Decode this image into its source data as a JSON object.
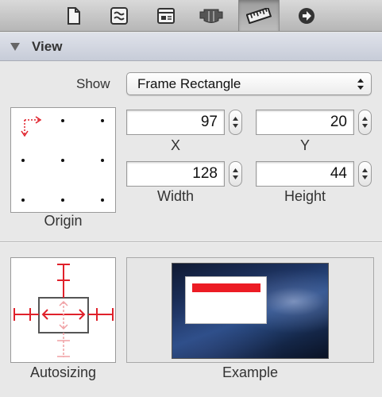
{
  "toolbar": {
    "tabs": [
      {
        "icon": "document-icon",
        "selected": false
      },
      {
        "icon": "quick-help-icon",
        "selected": false
      },
      {
        "icon": "identity-icon",
        "selected": false
      },
      {
        "icon": "attributes-icon",
        "selected": false
      },
      {
        "icon": "size-ruler-icon",
        "selected": true
      },
      {
        "icon": "connections-arrow-icon",
        "selected": false
      }
    ]
  },
  "section": {
    "title": "View"
  },
  "show": {
    "label": "Show",
    "value": "Frame Rectangle"
  },
  "origin": {
    "label": "Origin"
  },
  "fields": {
    "x": {
      "value": "97",
      "label": "X"
    },
    "y": {
      "value": "20",
      "label": "Y"
    },
    "width": {
      "value": "128",
      "label": "Width"
    },
    "height": {
      "value": "44",
      "label": "Height"
    }
  },
  "autosizing": {
    "label": "Autosizing"
  },
  "example": {
    "label": "Example"
  },
  "colors": {
    "strut_red": "#e0212b",
    "example_bar": "#ec1c24"
  }
}
